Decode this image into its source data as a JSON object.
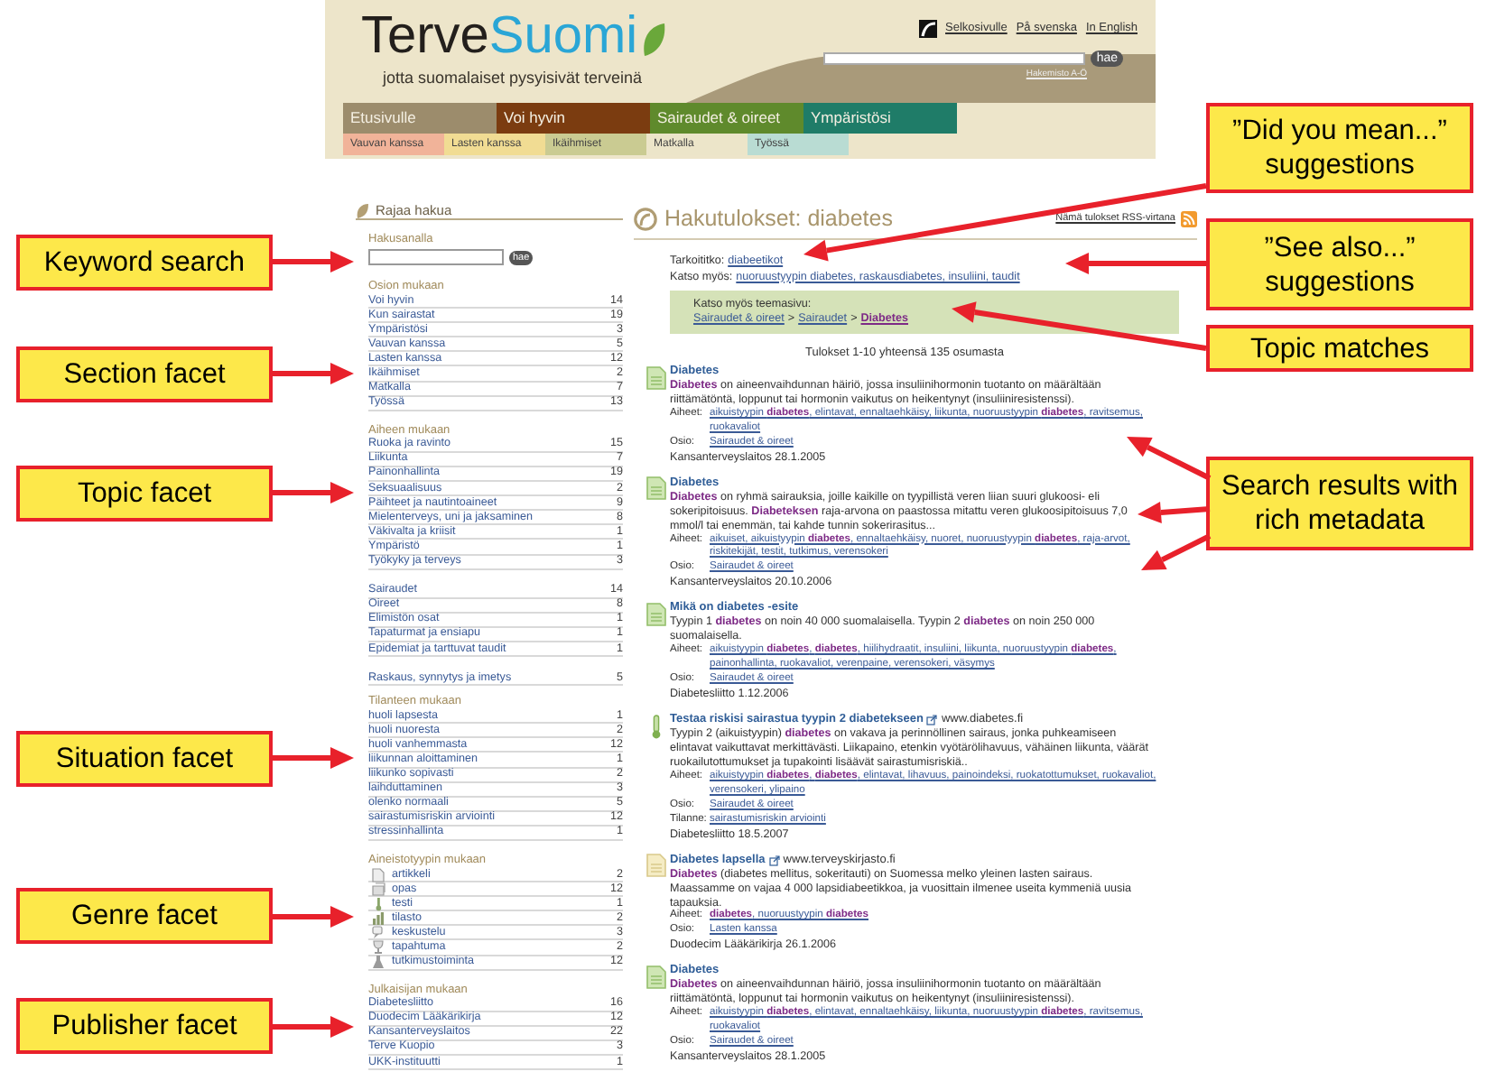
{
  "header": {
    "logo": {
      "part_1": "Terve",
      "part_2": "Suomi",
      "tagline": "jotta suomalaiset pysyisivät terveinä"
    },
    "top_links": [
      "Selkosivulle",
      "På svenska",
      "In English"
    ],
    "search": {
      "button": "hae"
    },
    "index_link": "Hakemisto A-Ö",
    "main_nav": [
      {
        "label": "Etusivulle",
        "color": "#9c8c6c"
      },
      {
        "label": "Voi hyvin",
        "color": "#7b3c10"
      },
      {
        "label": "Sairaudet & oireet",
        "color": "#5f8a2c"
      },
      {
        "label": "Ympäristösi",
        "color": "#1f7c68"
      }
    ],
    "sub_nav": [
      {
        "label": "Vauvan kanssa",
        "color": "#f1b399"
      },
      {
        "label": "Lasten kanssa",
        "color": "#f1dc93"
      },
      {
        "label": "Ikäihmiset",
        "color": "#cacb92"
      },
      {
        "label": "Matkalla",
        "color": "#ece5c9"
      },
      {
        "label": "Työssä",
        "color": "#b9dcd3"
      }
    ]
  },
  "facets": {
    "title": "Rajaa hakua",
    "keyword": {
      "label": "Hakusanalla",
      "button": "hae"
    },
    "groups": [
      {
        "title": "Osion mukaan",
        "items": [
          {
            "label": "Voi hyvin",
            "count": "14"
          },
          {
            "label": "Kun sairastat",
            "count": "19"
          },
          {
            "label": "Ympäristösi",
            "count": "3"
          },
          {
            "label": "Vauvan kanssa",
            "count": "5"
          },
          {
            "label": "Lasten kanssa",
            "count": "12"
          },
          {
            "label": "Ikäihmiset",
            "count": "2"
          },
          {
            "label": "Matkalla",
            "count": "7"
          },
          {
            "label": "Työssä",
            "count": "13"
          }
        ]
      },
      {
        "title": "Aiheen mukaan",
        "items": [
          {
            "label": "Ruoka ja ravinto",
            "count": "15"
          },
          {
            "label": "Liikunta",
            "count": "7"
          },
          {
            "label": "Painonhallinta",
            "count": "19"
          },
          {
            "label": "Seksuaalisuus",
            "count": "2"
          },
          {
            "label": "Päihteet ja nautintoaineet",
            "count": "9"
          },
          {
            "label": "Mielenterveys, uni ja jaksaminen",
            "count": "8"
          },
          {
            "label": "Väkivalta ja kriisit",
            "count": "1"
          },
          {
            "label": "Ympäristö",
            "count": "1"
          },
          {
            "label": "Työkyky ja terveys",
            "count": "3"
          }
        ]
      },
      {
        "items": [
          {
            "label": "Sairaudet",
            "count": "14"
          },
          {
            "label": "Oireet",
            "count": "8"
          },
          {
            "label": "Elimistön osat",
            "count": "1"
          },
          {
            "label": "Tapaturmat ja ensiapu",
            "count": "1"
          },
          {
            "label": "Epidemiat ja tarttuvat taudit",
            "count": "1"
          }
        ]
      },
      {
        "items": [
          {
            "label": "Raskaus, synnytys ja imetys",
            "count": "5"
          }
        ]
      },
      {
        "title": "Tilanteen mukaan",
        "items": [
          {
            "label": "huoli lapsesta",
            "count": "1"
          },
          {
            "label": "huoli nuoresta",
            "count": "2"
          },
          {
            "label": "huoli vanhemmasta",
            "count": "12"
          },
          {
            "label": "liikunnan aloittaminen",
            "count": "1"
          },
          {
            "label": "liikunko sopivasti",
            "count": "2"
          },
          {
            "label": "laihduttaminen",
            "count": "3"
          },
          {
            "label": "olenko normaali",
            "count": "5"
          },
          {
            "label": "sairastumisriskin arviointi",
            "count": "12"
          },
          {
            "label": "stressinhallinta",
            "count": "1"
          }
        ]
      },
      {
        "title": "Aineistotyypin mukaan",
        "items": [
          {
            "label": "artikkeli",
            "count": "2",
            "kind": "article"
          },
          {
            "label": "opas",
            "count": "12",
            "kind": "guide"
          },
          {
            "label": "testi",
            "count": "1",
            "kind": "test"
          },
          {
            "label": "tilasto",
            "count": "2",
            "kind": "statistics"
          },
          {
            "label": "keskustelu",
            "count": "3",
            "kind": "discussion"
          },
          {
            "label": "tapahtuma",
            "count": "2",
            "kind": "event"
          },
          {
            "label": "tutkimustoiminta",
            "count": "12",
            "kind": "research"
          }
        ]
      },
      {
        "title": "Julkaisijan mukaan",
        "items": [
          {
            "label": "Diabetesliitto",
            "count": "16"
          },
          {
            "label": "Duodecim Lääkärikirja",
            "count": "12"
          },
          {
            "label": "Kansanterveyslaitos",
            "count": "22"
          },
          {
            "label": "Terve Kuopio",
            "count": "3"
          },
          {
            "label": "UKK-instituutti",
            "count": "1"
          }
        ]
      }
    ]
  },
  "results": {
    "title": "Hakutulokset: diabetes",
    "rss_link": "Nämä tulokset RSS-virtana",
    "did_you_mean": {
      "label": "Tarkoititko:",
      "link": "diabeetikot"
    },
    "see_also": {
      "label": "Katso myös:",
      "link": "nuoruustyypin diabetes, raskausdiabetes, insuliini, taudit"
    },
    "theme_box": {
      "label": "Katso myös teemasivu:",
      "path": [
        {
          "label": "Sairaudet & oireet",
          "current": false
        },
        {
          "label": "Sairaudet",
          "current": false
        },
        {
          "label": "Diabetes",
          "current": true
        }
      ],
      "separator": ">"
    },
    "count": "Tulokset 1-10 yhteensä 135 osumasta",
    "items": [
      {
        "kind": "article",
        "title": "Diabetes",
        "external": false,
        "snippet": "**Diabetes** on aineenvaihdunnan häiriö, jossa insuliinihormonin tuotanto on määrältään riittämätöntä, loppunut tai hormonin vaikutus on heikentynyt (insuliiniresistenssi).",
        "meta": [
          {
            "label": "Aiheet:",
            "links": "aikuistyypin **diabetes**, elintavat, ennaltaehkäisy, liikunta, nuoruustyypin **diabetes**, ravitsemus, ruokavaliot"
          },
          {
            "label": "Osio:",
            "links": "Sairaudet & oireet"
          }
        ],
        "source": "Kansanterveyslaitos 28.1.2005"
      },
      {
        "kind": "article",
        "title": "Diabetes",
        "external": false,
        "snippet": "**Diabetes** on ryhmä sairauksia, joille kaikille on tyypillistä veren liian suuri glukoosi- eli sokeripitoisuus. **Diabeteksen** raja-arvona on paastossa mitattu veren glukoosipitoisuus 7,0 mmol/l tai enemmän, tai kahde tunnin sokerirasitus...",
        "meta": [
          {
            "label": "Aiheet:",
            "links": "aikuiset, aikuistyypin **diabetes**, ennaltaehkäisy, nuoret, nuoruustyypin **diabetes**, raja-arvot, riskitekijät, testit, tutkimus, verensokeri"
          },
          {
            "label": "Osio:",
            "links": "Sairaudet & oireet"
          }
        ],
        "source": "Kansanterveyslaitos 20.10.2006"
      },
      {
        "kind": "article",
        "title": "Mikä on diabetes -esite",
        "external": false,
        "snippet": "Tyypin 1 **diabetes** on noin 40 000 suomalaisella. Tyypin 2 **diabetes** on noin 250 000 suomalaisella.",
        "meta": [
          {
            "label": "Aiheet:",
            "links": "aikuistyypin **diabetes**, **diabetes**, hiilihydraatit, insuliini, liikunta, nuoruustyypin **diabetes**, painonhallinta, ruokavaliot, verenpaine, verensokeri, väsymys"
          },
          {
            "label": "Osio:",
            "links": "Sairaudet & oireet"
          }
        ],
        "source": "Diabetesliitto 1.12.2006"
      },
      {
        "kind": "test",
        "title": "Testaa riskisi sairastua tyypin 2 diabetekseen",
        "external": true,
        "site": "www.diabetes.fi",
        "snippet": "Tyypin 2 (aikuistyypin) **diabetes** on vakava ja perinnöllinen sairaus, jonka puhkeamiseen elintavat vaikuttavat merkittävästi. Liikapaino, etenkin vyötärölihavuus, vähäinen liikunta, väärät ruokailutottumukset ja tupakointi lisäävät sairastumisriskiä..",
        "meta": [
          {
            "label": "Aiheet:",
            "links": "aikuistyypin **diabetes**, **diabetes**, elintavat, lihavuus, painoindeksi, ruokatottumukset, ruokavaliot, verensokeri, ylipaino"
          },
          {
            "label": "Osio:",
            "links": "Sairaudet & oireet"
          },
          {
            "label": "Tilanne:",
            "links": "sairastumisriskin arviointi"
          }
        ],
        "source": "Diabetesliitto 18.5.2007"
      },
      {
        "kind": "guide",
        "title": "Diabetes lapsella",
        "external": true,
        "site": "www.terveyskirjasto.fi",
        "snippet": "**Diabetes** (diabetes mellitus, sokeritauti) on Suomessa melko yleinen lasten sairaus. Maassamme on vajaa 4 000 lapsidiabeetikkoa, ja vuosittain ilmenee useita kymmeniä uusia tapauksia.",
        "meta": [
          {
            "label": "Aiheet:",
            "links": "**diabetes**, nuoruustyypin **diabetes**"
          },
          {
            "label": "Osio:",
            "links": "Lasten kanssa"
          }
        ],
        "source": "Duodecim Lääkärikirja 26.1.2006"
      },
      {
        "kind": "article",
        "title": "Diabetes",
        "external": false,
        "snippet": "**Diabetes** on aineenvaihdunnan häiriö, jossa insuliinihormonin tuotanto on määrältään riittämätöntä, loppunut tai hormonin vaikutus on heikentynyt (insuliiniresistenssi).",
        "meta": [
          {
            "label": "Aiheet:",
            "links": "aikuistyypin **diabetes**, elintavat, ennaltaehkäisy, liikunta, nuoruustyypin **diabetes**, ravitsemus, ruokavaliot"
          },
          {
            "label": "Osio:",
            "links": "Sairaudet & oireet"
          }
        ],
        "source": "Kansanterveyslaitos 28.1.2005"
      }
    ]
  },
  "annotations": {
    "left": [
      "Keyword search",
      "Section facet",
      "Topic facet",
      "Situation facet",
      "Genre facet",
      "Publisher facet"
    ],
    "right": [
      "”Did you mean...” suggestions",
      "”See also...” suggestions",
      "Topic matches",
      "Search results with rich metadata"
    ]
  }
}
